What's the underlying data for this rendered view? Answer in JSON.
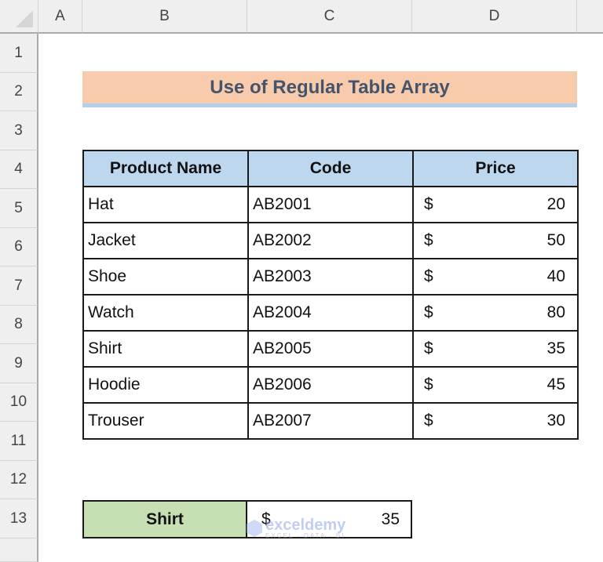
{
  "sheet": {
    "columns": [
      "A",
      "B",
      "C",
      "D"
    ],
    "rows": [
      "1",
      "2",
      "3",
      "4",
      "5",
      "6",
      "7",
      "8",
      "9",
      "10",
      "11",
      "12",
      "13"
    ]
  },
  "title": "Use of Regular Table Array",
  "table": {
    "headers": [
      "Product Name",
      "Code",
      "Price"
    ],
    "rows": [
      {
        "name": "Hat",
        "code": "AB2001",
        "currency": "$",
        "price": "20"
      },
      {
        "name": "Jacket",
        "code": "AB2002",
        "currency": "$",
        "price": "50"
      },
      {
        "name": "Shoe",
        "code": "AB2003",
        "currency": "$",
        "price": "40"
      },
      {
        "name": "Watch",
        "code": "AB2004",
        "currency": "$",
        "price": "80"
      },
      {
        "name": "Shirt",
        "code": "AB2005",
        "currency": "$",
        "price": "35"
      },
      {
        "name": "Hoodie",
        "code": "AB2006",
        "currency": "$",
        "price": "45"
      },
      {
        "name": "Trouser",
        "code": "AB2007",
        "currency": "$",
        "price": "30"
      }
    ]
  },
  "lookup": {
    "label": "Shirt",
    "currency": "$",
    "value": "35"
  },
  "watermark": {
    "brand": "exceldemy",
    "tagline": "EXCEL · DATA · BI"
  },
  "colors": {
    "title_fill": "#f8cbad",
    "title_text": "#44546a",
    "title_underline": "#b4cfea",
    "header_fill": "#bdd7ee",
    "lookup_fill": "#c6e0b4"
  }
}
